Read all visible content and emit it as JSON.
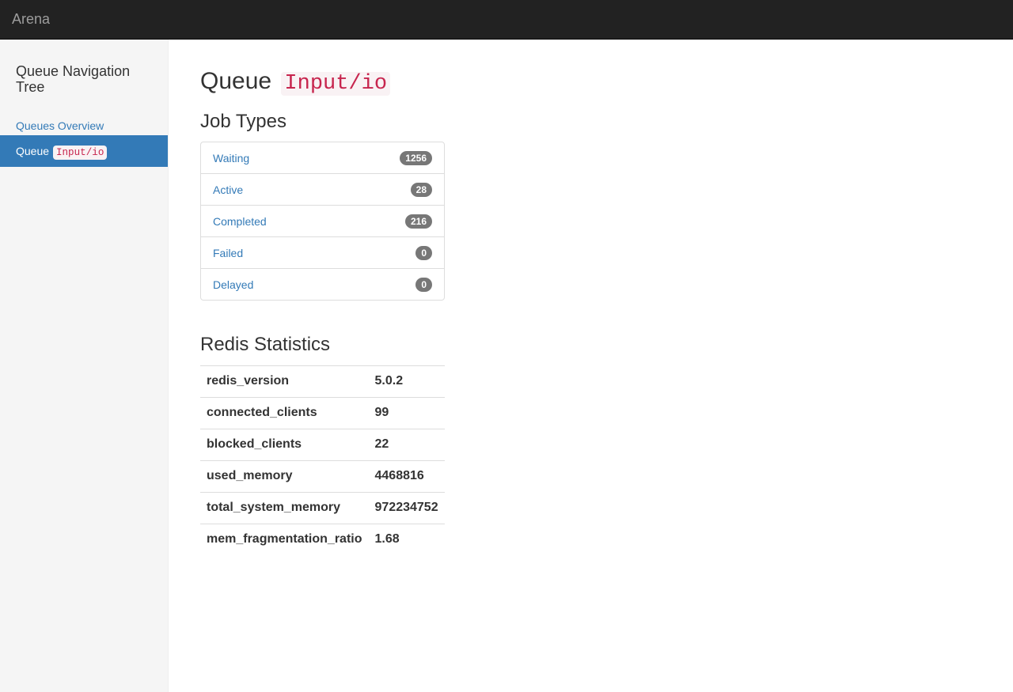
{
  "navbar": {
    "brand": "Arena"
  },
  "sidebar": {
    "title": "Queue Navigation Tree",
    "items": [
      {
        "label": "Queues Overview"
      },
      {
        "label": "Queue",
        "code": "Input/io"
      }
    ]
  },
  "main": {
    "heading_prefix": "Queue",
    "heading_code": "Input/io",
    "job_types_heading": "Job Types",
    "job_types": [
      {
        "label": "Waiting",
        "count": "1256"
      },
      {
        "label": "Active",
        "count": "28"
      },
      {
        "label": "Completed",
        "count": "216"
      },
      {
        "label": "Failed",
        "count": "0"
      },
      {
        "label": "Delayed",
        "count": "0"
      }
    ],
    "redis_heading": "Redis Statistics",
    "redis_stats": [
      {
        "key": "redis_version",
        "value": "5.0.2"
      },
      {
        "key": "connected_clients",
        "value": "99"
      },
      {
        "key": "blocked_clients",
        "value": "22"
      },
      {
        "key": "used_memory",
        "value": "4468816"
      },
      {
        "key": "total_system_memory",
        "value": "972234752"
      },
      {
        "key": "mem_fragmentation_ratio",
        "value": "1.68"
      }
    ]
  },
  "colors": {
    "navbar_bg": "#222222",
    "sidebar_bg": "#f5f5f5",
    "link": "#337ab7",
    "active_bg": "#337ab7",
    "code_text": "#c7254e",
    "code_bg": "#f9f2f4",
    "badge_bg": "#777777"
  }
}
